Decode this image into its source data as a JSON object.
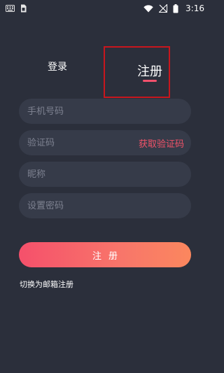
{
  "status_bar": {
    "time": "3:16",
    "icons": [
      "keyboard-icon",
      "sim-card-icon",
      "wifi-icon",
      "signal-off-icon",
      "battery-icon"
    ]
  },
  "tabs": {
    "login_label": "登录",
    "register_label": "注册",
    "active": "register"
  },
  "form": {
    "phone_placeholder": "手机号码",
    "code_placeholder": "验证码",
    "get_code_label": "获取验证码",
    "nickname_placeholder": "昵称",
    "password_placeholder": "设置密码",
    "phone_value": "",
    "code_value": "",
    "nickname_value": "",
    "password_value": ""
  },
  "submit_label": "注册",
  "switch_label": "切换为邮箱注册",
  "colors": {
    "background": "#2b2f3b",
    "field_background": "#363b49",
    "accent": "#f25369",
    "gradient_start": "#f5506b",
    "gradient_end": "#fb875e",
    "highlight_box": "#c8161d"
  }
}
